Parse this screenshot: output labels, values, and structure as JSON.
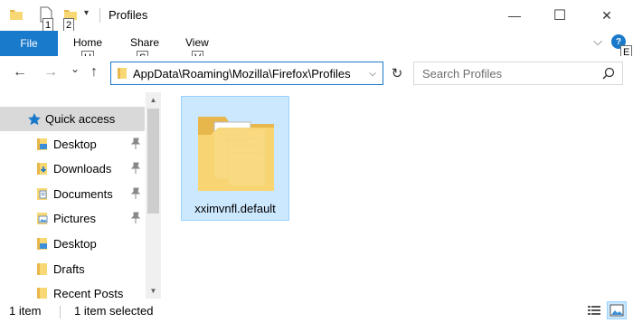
{
  "window": {
    "title": "Profiles",
    "minimize_glyph": "—",
    "maximize_glyph": "☐",
    "close_glyph": "✕"
  },
  "quick_access_toolbar": {
    "keytip_1": "1",
    "keytip_2": "2",
    "customize_glyph": "▾"
  },
  "ribbon": {
    "file_label": "File",
    "tabs": [
      {
        "label": "Home",
        "keytip": "H"
      },
      {
        "label": "Share",
        "keytip": "S"
      },
      {
        "label": "View",
        "keytip": "V"
      }
    ],
    "expand_glyph": "⌵",
    "help_label": "?",
    "help_keytip": "E"
  },
  "address_bar": {
    "back_glyph": "←",
    "forward_glyph": "→",
    "recent_glyph": "⌄",
    "up_glyph": "↑",
    "path": "AppData\\Roaming\\Mozilla\\Firefox\\Profiles",
    "dropdown_glyph": "⌵",
    "refresh_glyph": "↻"
  },
  "search": {
    "placeholder": "Search Profiles"
  },
  "nav_pane": {
    "items": [
      {
        "label": "Quick access",
        "icon": "star-icon",
        "pinned": false
      },
      {
        "label": "Desktop",
        "icon": "desktop-folder-icon",
        "pinned": true
      },
      {
        "label": "Downloads",
        "icon": "downloads-folder-icon",
        "pinned": true
      },
      {
        "label": "Documents",
        "icon": "documents-folder-icon",
        "pinned": true
      },
      {
        "label": "Pictures",
        "icon": "pictures-folder-icon",
        "pinned": true
      },
      {
        "label": "Desktop",
        "icon": "desktop-folder-icon",
        "pinned": false
      },
      {
        "label": "Drafts",
        "icon": "folder-icon",
        "pinned": false
      },
      {
        "label": "Recent Posts",
        "icon": "folder-icon",
        "pinned": false
      }
    ]
  },
  "content": {
    "items": [
      {
        "name": "xximvnfl.default",
        "type": "folder",
        "selected": true
      }
    ]
  },
  "status_bar": {
    "item_count": "1 item",
    "selection": "1 item selected"
  },
  "colors": {
    "accent": "#1979ca",
    "selection_bg": "#cce8ff",
    "selection_border": "#99d1ff",
    "folder_yellow": "#f8d775"
  }
}
